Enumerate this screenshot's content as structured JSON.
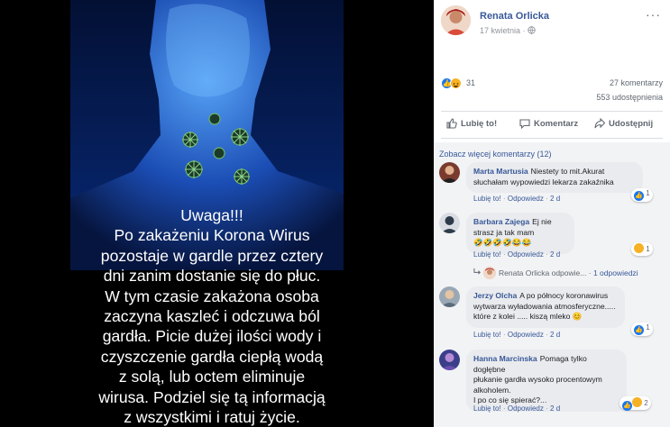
{
  "post": {
    "image_text": [
      "Uwaga!!!",
      "Po zakażeniu Korona Wirus",
      "pozostaje w gardle przez cztery",
      "dni zanim dostanie się do płuc.",
      "W tym czasie zakażona osoba",
      "zaczyna kaszleć i odczuwa ból",
      "gardła. Picie dużej ilości wody i",
      "czyszczenie gardła ciepłą wodą",
      "z solą, lub octem eliminuje",
      "wirusa. Podziel się tą informacją",
      "z wszystkimi i ratuj życie."
    ]
  },
  "author": {
    "name": "Renata Orlicka",
    "date": "17 kwietnia",
    "separator": "·",
    "more": "···"
  },
  "stats": {
    "reaction_count": "31",
    "comments": "27 komentarzy",
    "shares": "553 udostępnienia"
  },
  "actions": {
    "like": "Lubię to!",
    "comment": "Komentarz",
    "share": "Udostępnij"
  },
  "see_more": "Zobacz więcej komentarzy (12)",
  "comment_footer": {
    "like": "Lubię to!",
    "reply": "Odpowiedz",
    "sep": "·"
  },
  "comments": [
    {
      "name": "Marta Martusia",
      "lines": [
        "Niestety to mit.Akurat",
        "słuchałam wypowiedzi lekarza zakaźnika"
      ],
      "time": "2 d",
      "badge": "1",
      "avatar_color": "#7a3b2e"
    },
    {
      "name": "Barbara Zajega",
      "lines": [
        "Ej nie strasz ja tak mam",
        "🤣🤣🤣🤣😂😂"
      ],
      "time": "2 d",
      "badge": "1",
      "avatar_color": "#2d3b4a"
    },
    {
      "name": "Jerzy Olcha",
      "lines": [
        "A po północy koronawirus",
        "wytwarza wyładowania atmosferyczne.....",
        "które z kolei ..... kiszą mleko 😊"
      ],
      "time": "2 d",
      "badge": "1",
      "avatar_color": "#5a6b7a"
    },
    {
      "name": "Hanna Marcinska",
      "lines": [
        "Pomaga tylko dogłębne",
        "płukanie gardła wysoko procentowym",
        "alkoholem.",
        "I po co się spierać?..."
      ],
      "time": "2 d",
      "badge": "2",
      "avatar_color": "#3b3f8a"
    }
  ],
  "reply": {
    "name": "Renata Orlicka",
    "suffix": "odpowie...",
    "sep": "·",
    "count": "1 odpowiedzi"
  },
  "colors": {
    "link": "#385898",
    "like_blue": "#1877f2",
    "bubble": "#e9ebee",
    "panel": "#f2f3f5"
  },
  "icons": [
    "like-icon",
    "haha-icon",
    "comment-icon",
    "share-icon",
    "globe-icon",
    "reply-arrow-icon"
  ]
}
